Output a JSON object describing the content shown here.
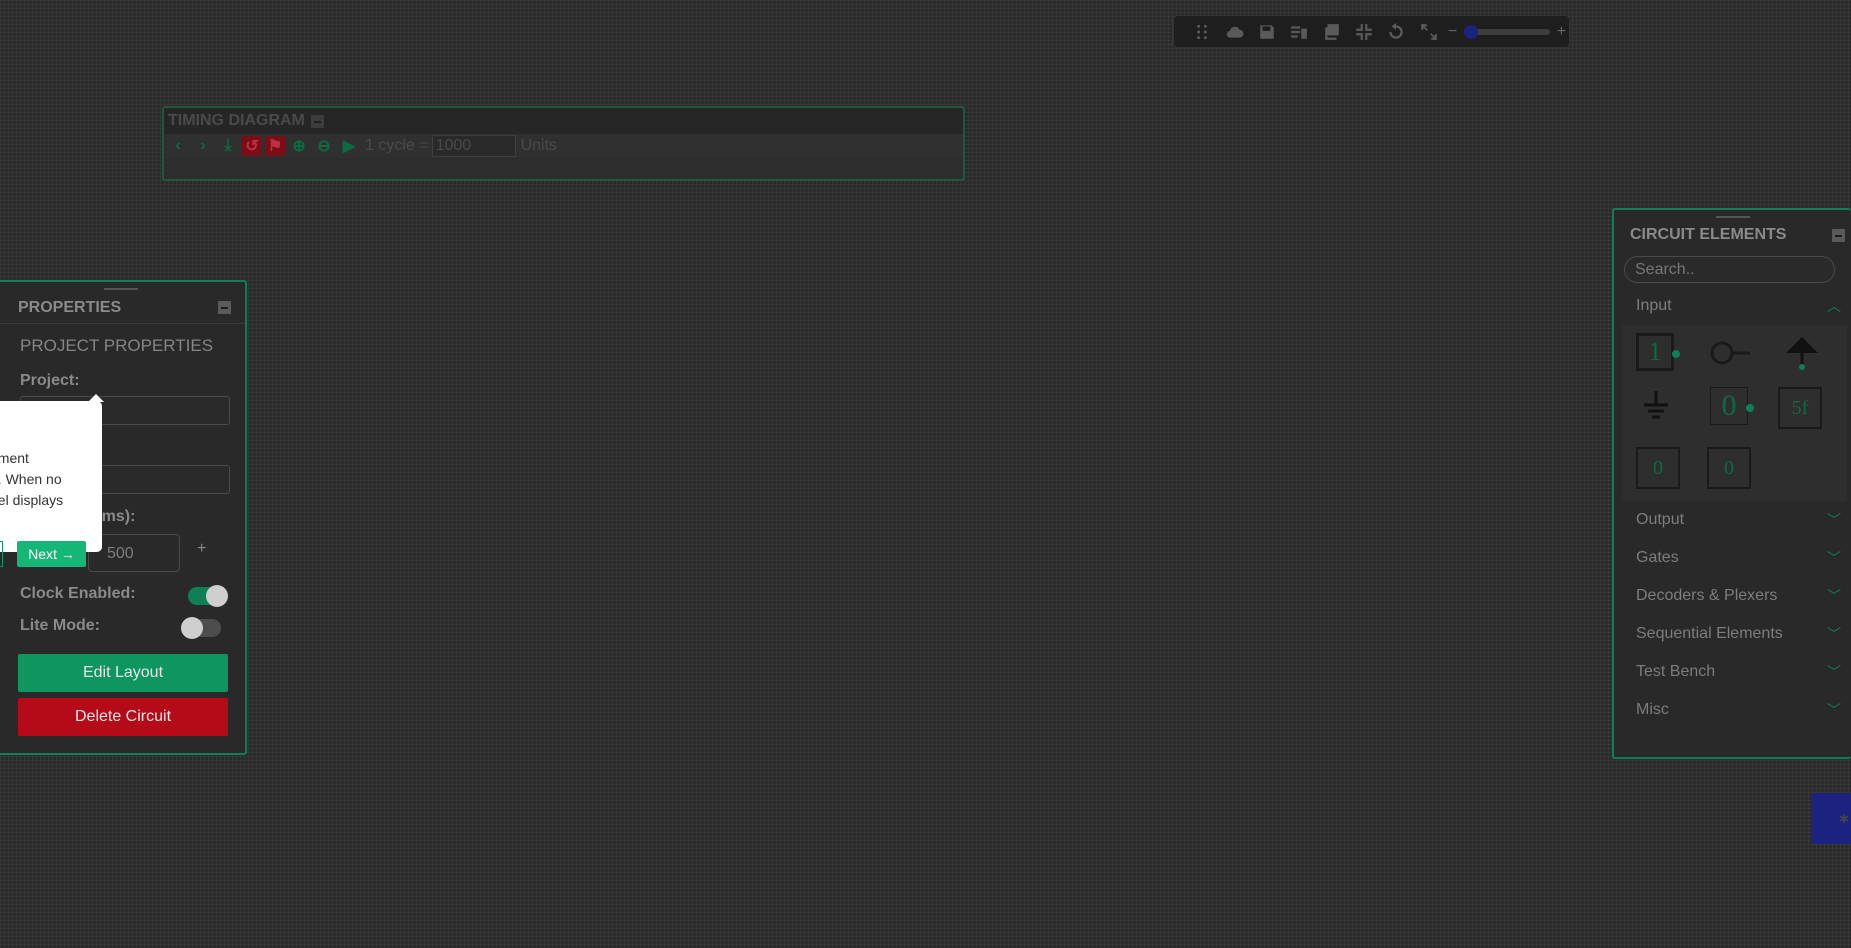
{
  "timing": {
    "title": "TIMING DIAGRAM",
    "cycle_label": "1 cycle =",
    "cycle_value": "1000",
    "units": "Units"
  },
  "properties": {
    "title": "PROPERTIES",
    "subtitle": "PROJECT PROPERTIES",
    "project_label": "Project:",
    "clock_time_label": "e (ms):",
    "clock_time_value": "500",
    "plus": "+",
    "clock_enabled_label": "Clock Enabled:",
    "clock_enabled": true,
    "lite_mode_label": "Lite Mode:",
    "lite_mode": false,
    "edit_layout": "Edit Layout",
    "delete_circuit": "Delete Circuit"
  },
  "popover": {
    "lines": [
      "ement",
      "d. When no",
      "nel displays"
    ],
    "next": "Next →"
  },
  "elements": {
    "title": "CIRCUIT ELEMENTS",
    "search_placeholder": "Search..",
    "categories": [
      "Input",
      "Output",
      "Gates",
      "Decoders & Plexers",
      "Sequential Elements",
      "Test Bench",
      "Misc"
    ],
    "input_items": {
      "one": "1",
      "zero": "0",
      "hex": "5f",
      "cnt1": "0",
      "cnt2": "0"
    }
  },
  "colors": {
    "accent": "#0f8055",
    "danger": "#b50a18",
    "background": "#2b2b2b"
  },
  "toolbar_icons": [
    "drag-icon",
    "cloud-upload-icon",
    "save-icon",
    "delete-icon",
    "copy-icon",
    "fit-icon",
    "undo-icon",
    "fullscreen-icon"
  ]
}
